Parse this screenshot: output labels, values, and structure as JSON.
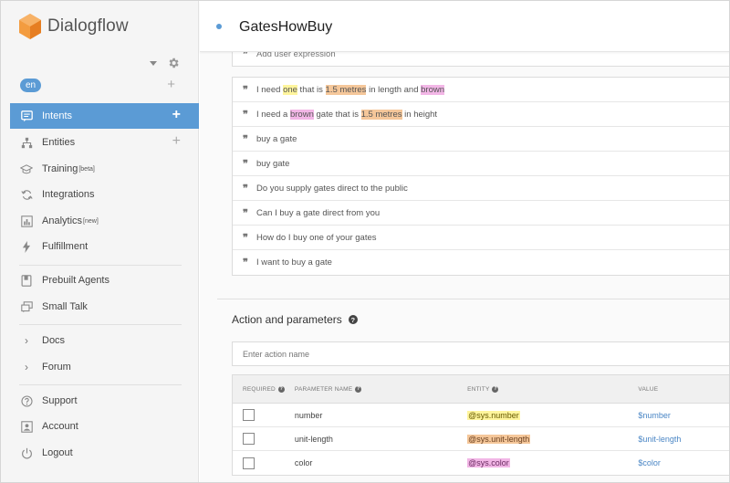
{
  "app": {
    "name": "Dialogflow"
  },
  "agent": {
    "language": "en"
  },
  "sidebar": {
    "items": [
      {
        "label": "Intents",
        "icon": "chat-icon",
        "badge": "",
        "active": true,
        "add": true
      },
      {
        "label": "Entities",
        "icon": "sitemap-icon",
        "badge": "",
        "active": false,
        "add": true
      },
      {
        "label": "Training",
        "icon": "graduation-cap-icon",
        "badge": "[beta]",
        "active": false,
        "add": false
      },
      {
        "label": "Integrations",
        "icon": "sync-icon",
        "badge": "",
        "active": false,
        "add": false
      },
      {
        "label": "Analytics",
        "icon": "bar-chart-icon",
        "badge": "[new]",
        "active": false,
        "add": false
      },
      {
        "label": "Fulfillment",
        "icon": "bolt-icon",
        "badge": "",
        "active": false,
        "add": false
      },
      {
        "label": "Prebuilt Agents",
        "icon": "book-icon",
        "badge": "",
        "active": false,
        "add": false
      },
      {
        "label": "Small Talk",
        "icon": "chat-bubbles-icon",
        "badge": "",
        "active": false,
        "add": false
      },
      {
        "label": "Docs",
        "icon": "chevron-right-icon",
        "badge": "",
        "active": false,
        "add": false
      },
      {
        "label": "Forum",
        "icon": "chevron-right-icon",
        "badge": "",
        "active": false,
        "add": false
      },
      {
        "label": "Support",
        "icon": "help-circle-icon",
        "badge": "",
        "active": false,
        "add": false
      },
      {
        "label": "Account",
        "icon": "account-icon",
        "badge": "",
        "active": false,
        "add": false
      },
      {
        "label": "Logout",
        "icon": "power-icon",
        "badge": "",
        "active": false,
        "add": false
      }
    ]
  },
  "intent": {
    "name": "GatesHowBuy"
  },
  "training_phrases": {
    "placeholder": "Add user expression",
    "phrases": [
      [
        {
          "t": "I need "
        },
        {
          "t": "one",
          "hl": "yellow"
        },
        {
          "t": " that is "
        },
        {
          "t": "1.5 metres",
          "hl": "orange"
        },
        {
          "t": " in length and "
        },
        {
          "t": "brown",
          "hl": "pink"
        }
      ],
      [
        {
          "t": "I need a "
        },
        {
          "t": "brown",
          "hl": "pink"
        },
        {
          "t": " gate that is "
        },
        {
          "t": "1.5 metres",
          "hl": "orange"
        },
        {
          "t": " in height"
        }
      ],
      [
        {
          "t": "buy a gate"
        }
      ],
      [
        {
          "t": "buy gate"
        }
      ],
      [
        {
          "t": "Do you supply gates direct to the public"
        }
      ],
      [
        {
          "t": "Can I buy a gate direct from you"
        }
      ],
      [
        {
          "t": "How do I buy one of your gates"
        }
      ],
      [
        {
          "t": "I want to buy a gate"
        }
      ]
    ]
  },
  "actions": {
    "title": "Action and parameters",
    "action_placeholder": "Enter action name",
    "columns": {
      "required": "REQUIRED",
      "name": "PARAMETER NAME",
      "entity": "ENTITY",
      "value": "VALUE"
    },
    "params": [
      {
        "name": "number",
        "entity": "@sys.number",
        "entity_color": "yellow",
        "value": "$number"
      },
      {
        "name": "unit-length",
        "entity": "@sys.unit-length",
        "entity_color": "orange",
        "value": "$unit-length"
      },
      {
        "name": "color",
        "entity": "@sys.color",
        "entity_color": "pink",
        "value": "$color"
      }
    ]
  },
  "colors": {
    "accent": "#5b9bd5",
    "highlight_yellow": "#fff59d",
    "highlight_orange": "#f5c79a",
    "highlight_pink": "#f2b6e6"
  }
}
